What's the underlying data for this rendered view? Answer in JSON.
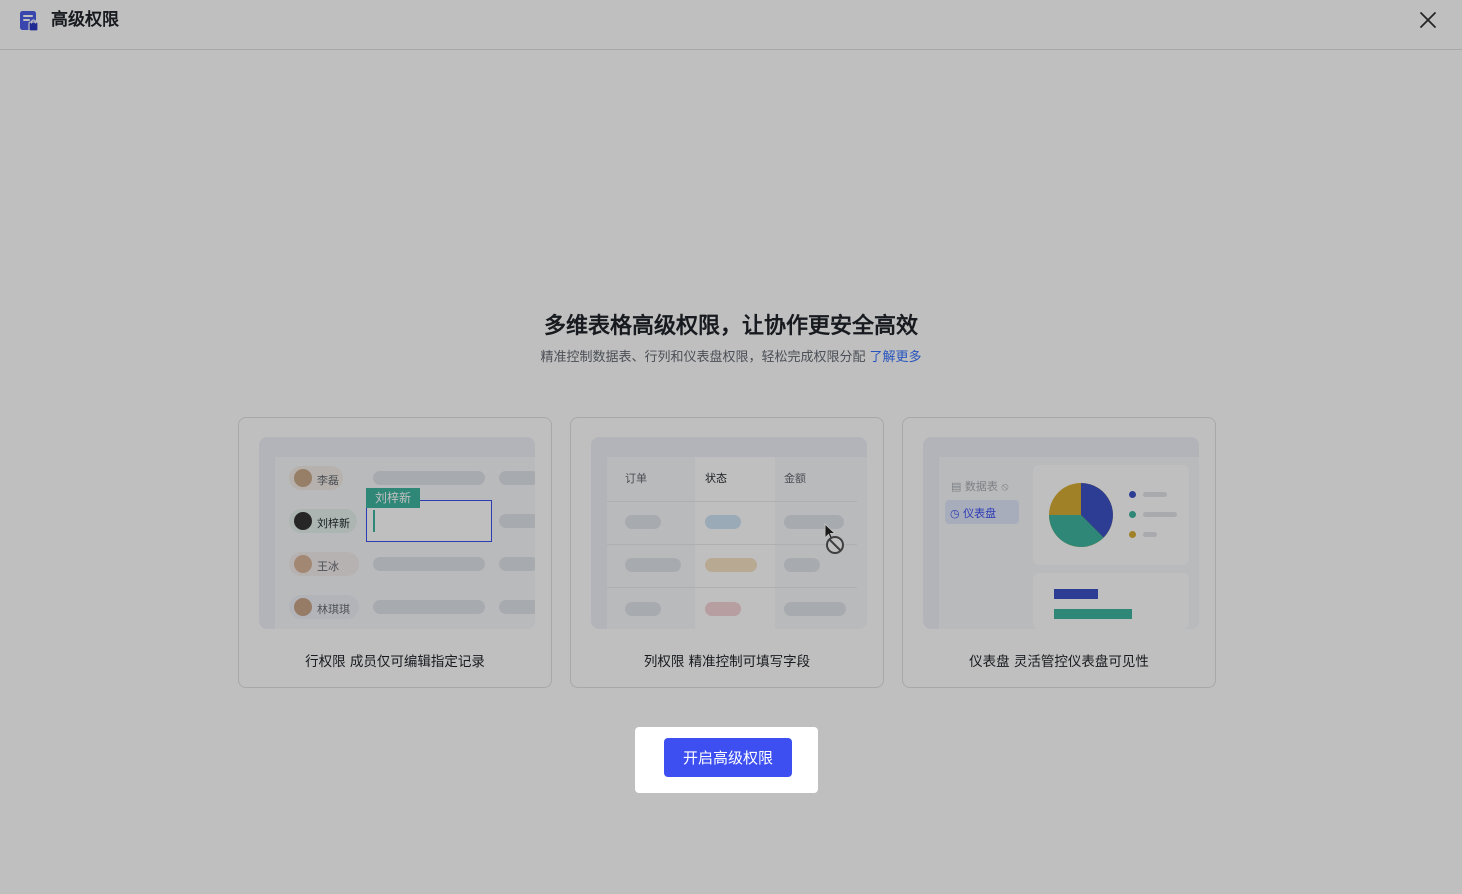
{
  "header": {
    "title": "高级权限",
    "app_icon": "table-lock-icon",
    "close_icon": "close-icon"
  },
  "main": {
    "heading": "多维表格高级权限，让协作更安全高效",
    "subtitle": "精准控制数据表、行列和仪表盘权限，轻松完成权限分配",
    "learn_more": "了解更多"
  },
  "cards": [
    {
      "caption": "行权限 成员仅可编辑指定记录",
      "names": [
        "李磊",
        "刘梓新",
        "王冰",
        "林琪琪"
      ],
      "editor_tag": "刘梓新"
    },
    {
      "caption": "列权限 精准控制可填写字段",
      "columns": [
        "订单",
        "状态",
        "金额"
      ]
    },
    {
      "caption": "仪表盘 灵活管控仪表盘可见性",
      "menu": [
        "数据表",
        "仪表盘"
      ]
    }
  ],
  "cta": {
    "label": "开启高级权限"
  },
  "colors": {
    "accent": "#3d4ff0",
    "link": "#3370ff",
    "teal": "#3fb5a0",
    "mustard": "#d6ad35"
  }
}
